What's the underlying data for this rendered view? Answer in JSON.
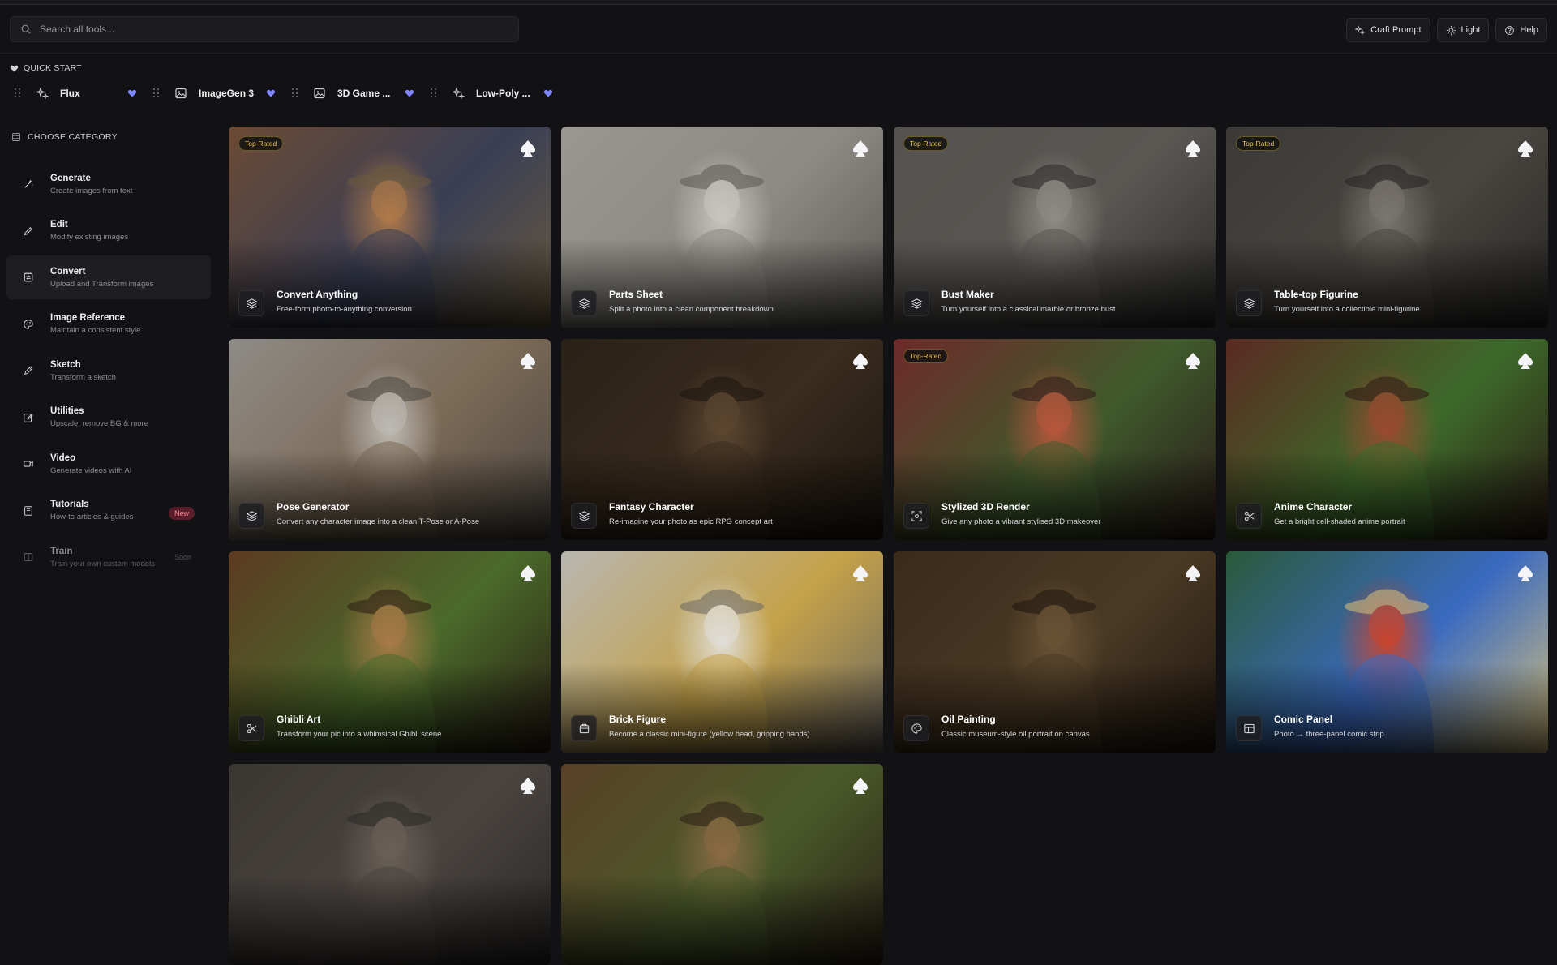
{
  "search": {
    "placeholder": "Search all tools..."
  },
  "header_buttons": [
    {
      "label": "Craft Prompt",
      "icon": "sparkle-icon"
    },
    {
      "label": "Light",
      "icon": "sun-icon"
    },
    {
      "label": "Help",
      "icon": "help-icon"
    }
  ],
  "quick_start": {
    "title": "QUICK START",
    "items": [
      {
        "label": "Flux",
        "icon": "sparkle-icon"
      },
      {
        "label": "ImageGen 3",
        "icon": "image-icon"
      },
      {
        "label": "3D Game ...",
        "icon": "image-icon"
      },
      {
        "label": "Low-Poly ...",
        "icon": "sparkle-icon"
      }
    ]
  },
  "category": {
    "title": "CHOOSE CATEGORY",
    "items": [
      {
        "name": "Generate",
        "desc": "Create images from text",
        "icon": "wand-icon"
      },
      {
        "name": "Edit",
        "desc": "Modify existing images",
        "icon": "pencil-icon"
      },
      {
        "name": "Convert",
        "desc": "Upload and Transform images",
        "icon": "convert-icon",
        "active": true
      },
      {
        "name": "Image Reference",
        "desc": "Maintain a consistent style",
        "icon": "palette-icon"
      },
      {
        "name": "Sketch",
        "desc": "Transform a sketch",
        "icon": "pen-icon"
      },
      {
        "name": "Utilities",
        "desc": "Upscale, remove BG & more",
        "icon": "edit-box-icon"
      },
      {
        "name": "Video",
        "desc": "Generate videos with AI",
        "icon": "video-icon"
      },
      {
        "name": "Tutorials",
        "desc": "How-to articles & guides",
        "icon": "book-icon",
        "badge": "New"
      },
      {
        "name": "Train",
        "desc": "Train your own custom models",
        "icon": "train-icon",
        "badge": "Soon",
        "dim": true
      }
    ]
  },
  "top_rated_label": "Top-Rated",
  "cards": [
    {
      "title": "Convert Anything",
      "desc": "Free-form photo-to-anything conversion",
      "top": true,
      "icon": "layers-icon",
      "colors": [
        "#6b4a34",
        "#b07a4a",
        "#3a3f55",
        "#6a5a3e"
      ]
    },
    {
      "title": "Parts Sheet",
      "desc": "Split a photo into a clean component breakdown",
      "top": false,
      "icon": "layers-icon",
      "colors": [
        "#9a9790",
        "#c9c6c0",
        "#8c8982",
        "#5a5854"
      ]
    },
    {
      "title": "Bust Maker",
      "desc": "Turn yourself into a classical marble or bronze bust",
      "top": true,
      "icon": "layers-icon",
      "colors": [
        "#55524f",
        "#8f8b86",
        "#5a5753",
        "#2c2b29"
      ]
    },
    {
      "title": "Table-top Figurine",
      "desc": "Turn yourself into a collectible mini-figurine",
      "top": true,
      "icon": "layers-icon",
      "colors": [
        "#3b3a38",
        "#7a7670",
        "#4a4641",
        "#262523"
      ]
    },
    {
      "title": "Pose Generator",
      "desc": "Convert any character image into a clean T-Pose or A-Pose",
      "top": false,
      "icon": "layers-icon",
      "colors": [
        "#8e8b86",
        "#bdbab4",
        "#7b6a56",
        "#4a4540"
      ]
    },
    {
      "title": "Fantasy Character",
      "desc": "Re-imagine your photo as epic RPG concept art",
      "top": false,
      "icon": "layers-icon",
      "colors": [
        "#2a2118",
        "#5c4630",
        "#3a2c1e",
        "#1a1510"
      ]
    },
    {
      "title": "Stylized 3D Render",
      "desc": "Give any photo a vibrant stylised 3D makeover",
      "top": true,
      "icon": "focus-icon",
      "colors": [
        "#6e2a2a",
        "#b8563c",
        "#3f5a2c",
        "#2a1a18"
      ]
    },
    {
      "title": "Anime Character",
      "desc": "Get a bright cell-shaded anime portrait",
      "top": false,
      "icon": "scissors-icon",
      "colors": [
        "#5a2a22",
        "#9a4a30",
        "#3d6a2a",
        "#2a1814"
      ]
    },
    {
      "title": "Ghibli Art",
      "desc": "Transform your pic into a whimsical Ghibli scene",
      "top": false,
      "icon": "scissors-icon",
      "colors": [
        "#5c3a22",
        "#a87a48",
        "#4a6a2a",
        "#2a1e14"
      ]
    },
    {
      "title": "Brick Figure",
      "desc": "Become a classic mini-figure (yellow head, gripping hands)",
      "top": false,
      "icon": "box-icon",
      "colors": [
        "#b8b6b0",
        "#e0ded8",
        "#c4a24a",
        "#6a6660"
      ]
    },
    {
      "title": "Oil Painting",
      "desc": "Classic museum-style oil portrait on canvas",
      "top": false,
      "icon": "palette-icon",
      "colors": [
        "#3a2a1a",
        "#6a5236",
        "#4a3a24",
        "#1e1610"
      ]
    },
    {
      "title": "Comic Panel",
      "desc": "Photo → three-panel comic strip",
      "top": false,
      "icon": "panel-icon",
      "colors": [
        "#2a5a3a",
        "#c8452e",
        "#3a6ac0",
        "#d8c27a"
      ]
    },
    {
      "title": "",
      "desc": "",
      "top": false,
      "icon": "",
      "colors": [
        "#3a3632",
        "#6a6058",
        "#4a4440",
        "#2a2826"
      ]
    },
    {
      "title": "",
      "desc": "",
      "top": false,
      "icon": "",
      "colors": [
        "#5a4028",
        "#8a6a44",
        "#4a5a2a",
        "#2a2016"
      ]
    }
  ]
}
